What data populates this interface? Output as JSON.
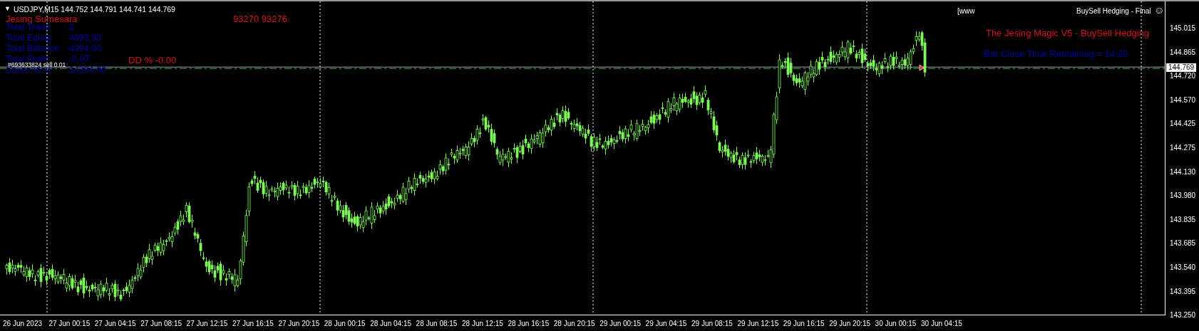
{
  "chart_header": {
    "collapse_arrow": "▼",
    "text": "USDJPY,M15  144.752 144.791 144.741 144.769"
  },
  "expert": {
    "prefix": "[www",
    "name": "BuySell Hedging - Final",
    "smiley": "☺"
  },
  "info_panel": {
    "owner": "Jesing Sumesara",
    "tickets": "93270 93276",
    "drawdown": "DD % -0.00",
    "stats": [
      {
        "label": "Total Trade",
        "value": ": 2"
      },
      {
        "label": "Total Equity",
        "value": ": 4393.93"
      },
      {
        "label": "Total Balance",
        "value": ": 4394.00"
      },
      {
        "label": "Total Profit",
        "value": ": -0.07"
      },
      {
        "label": "Close All At",
        "value": ": 14394.00"
      }
    ]
  },
  "order_line": {
    "label": "#693633824 sell 0.01",
    "price": "144.769"
  },
  "ea_title": "The Jesing Magic V5 - BuySell Hedging",
  "bar_timer": "Bar Close Time Remaining = 14:29",
  "price_axis": [
    "145.015",
    "144.865",
    "144.720",
    "144.570",
    "144.425",
    "144.275",
    "144.130",
    "143.980",
    "143.835",
    "143.685",
    "143.540",
    "143.395",
    "143.250"
  ],
  "time_axis": [
    "26 Jun 2023",
    "27 Jun 00:15",
    "27 Jun 04:15",
    "27 Jun 08:15",
    "27 Jun 12:15",
    "27 Jun 16:15",
    "27 Jun 20:15",
    "28 Jun 00:15",
    "28 Jun 04:15",
    "28 Jun 08:15",
    "28 Jun 12:15",
    "28 Jun 16:15",
    "28 Jun 20:15",
    "29 Jun 00:15",
    "29 Jun 04:15",
    "29 Jun 08:15",
    "29 Jun 12:15",
    "29 Jun 16:15",
    "29 Jun 20:15",
    "30 Jun 00:15",
    "30 Jun 04:15"
  ]
}
